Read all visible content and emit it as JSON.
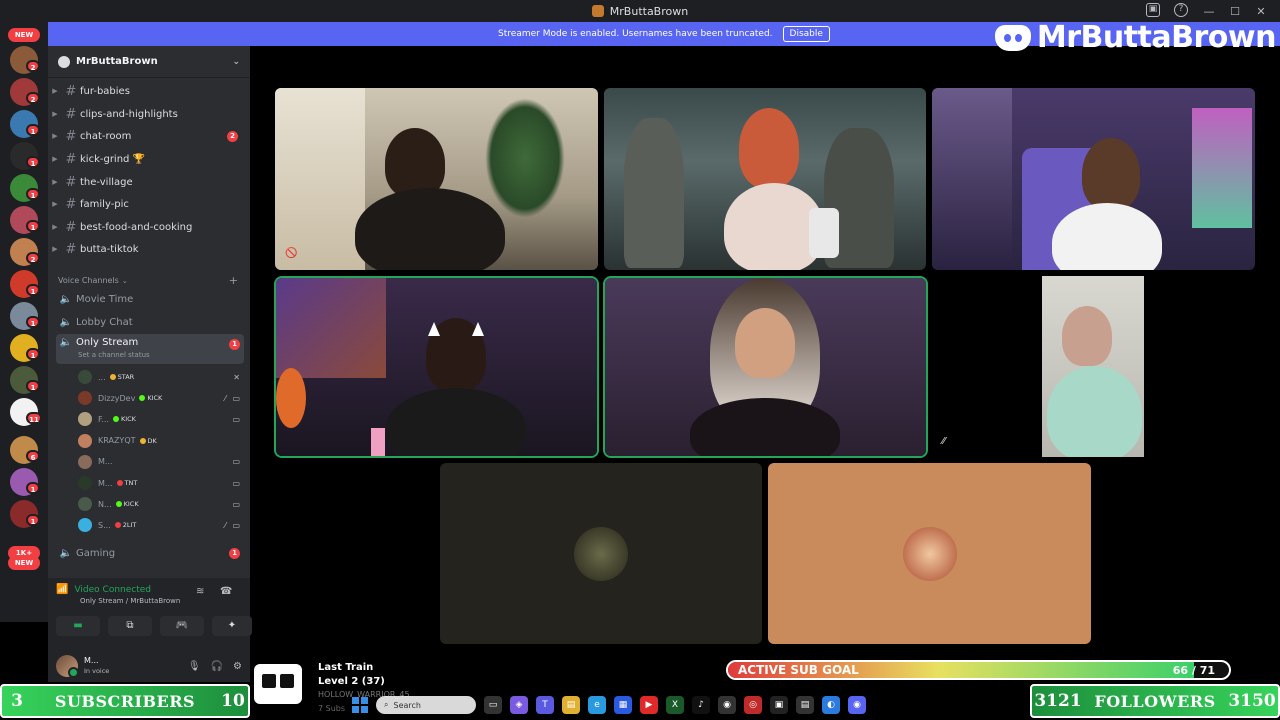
{
  "window": {
    "title": "MrButtaBrown"
  },
  "banner": {
    "text": "Streamer Mode is enabled. Usernames have been truncated.",
    "disable_label": "Disable"
  },
  "brand": {
    "name": "MrButtaBrown"
  },
  "rail": {
    "top_badge": "NEW",
    "bottom_badge_count": "1K+",
    "bottom_badge_new": "NEW",
    "counts": [
      "2",
      "2",
      "1",
      "1",
      "1",
      "1",
      "2",
      "1",
      "1",
      "1",
      "1",
      "1",
      "11",
      "6",
      "1",
      "1"
    ]
  },
  "server": {
    "name": "MrButtaBrown"
  },
  "text_channels": [
    {
      "name": "fur-babies",
      "mention": ""
    },
    {
      "name": "clips-and-highlights",
      "mention": ""
    },
    {
      "name": "chat-room",
      "mention": "2"
    },
    {
      "name": "kick-grind 🏆",
      "mention": ""
    },
    {
      "name": "the-village",
      "mention": ""
    },
    {
      "name": "family-pic",
      "mention": ""
    },
    {
      "name": "best-food-and-cooking",
      "mention": ""
    },
    {
      "name": "butta-tiktok",
      "mention": ""
    }
  ],
  "voice_header": "Voice Channels",
  "voice_channels": [
    {
      "name": "Movie Time"
    },
    {
      "name": "Lobby Chat"
    },
    {
      "name": "Only Stream",
      "status": "Set a channel status",
      "mention": "1"
    },
    {
      "name": "Gaming",
      "mention": "1"
    }
  ],
  "voice_users": [
    {
      "name": "...",
      "tag": "STAR",
      "tag_color": "#f0b232",
      "avatar": "#3a4a3a"
    },
    {
      "name": "DizzyDev",
      "tag": "KICK",
      "tag_color": "#53fc18",
      "avatar": "#7a3a2a"
    },
    {
      "name": "F...",
      "tag": "KICK",
      "tag_color": "#53fc18",
      "avatar": "#b0a080"
    },
    {
      "name": "KRAZYQT",
      "tag": "DK",
      "tag_color": "#f0b232",
      "avatar": "#c08060"
    },
    {
      "name": "M...",
      "tag": "",
      "tag_color": "#000000",
      "avatar": "#8a6a5a"
    },
    {
      "name": "M...",
      "tag": "TNT",
      "tag_color": "#f23f43",
      "avatar": "#2a3a2a"
    },
    {
      "name": "N...",
      "tag": "KICK",
      "tag_color": "#53fc18",
      "avatar": "#4a5a4a"
    },
    {
      "name": "S...",
      "tag": "2LIT",
      "tag_color": "#f23f43",
      "avatar": "#3ab0e0"
    }
  ],
  "voice_panel": {
    "title": "Video Connected",
    "subtitle": "Only Stream / MrButtaBrown"
  },
  "user_panel": {
    "name": "M...",
    "status": "In voice"
  },
  "overlay": {
    "subs": {
      "current": "3",
      "label": "SUBSCRIBERS",
      "goal": "10"
    },
    "followers": {
      "current": "3121",
      "label": "FOLLOWERS",
      "goal": "3150"
    },
    "sub_goal": {
      "label": "ACTIVE SUB GOAL",
      "count": "66 / 71",
      "progress": 0.93
    },
    "now_playing": {
      "title": "Last Train",
      "level": "Level 2  (37)",
      "ghost1": "HOLLOW_WARRIOR_45",
      "ghost2": "7 Subs"
    }
  },
  "taskbar": {
    "search_placeholder": "Search"
  },
  "colors": {
    "blurple": "#5865f2",
    "green": "#23a55a",
    "red": "#f23f43",
    "sidebar": "#2b2d31"
  }
}
